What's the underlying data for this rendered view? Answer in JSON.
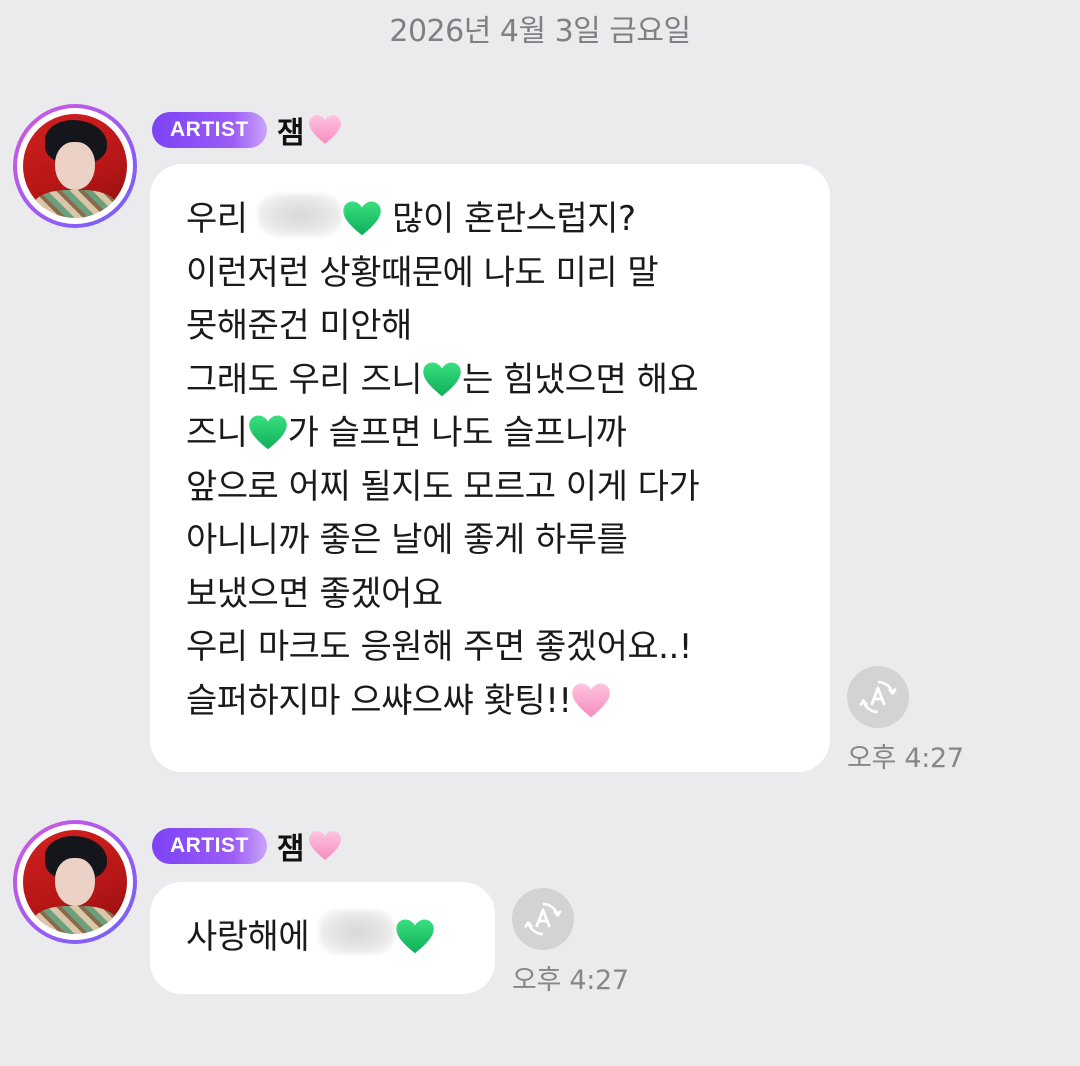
{
  "date_divider": "2026년 4월 3일 금요일",
  "colors": {
    "background": "#ebebed",
    "bubble": "#ffffff",
    "badge_gradient_start": "#7c43f5",
    "badge_gradient_end": "#c9a4f9",
    "heart_green": "#1fc46a",
    "heart_pink": "#f9a8cf",
    "avatar_ring": "#9a5cf2",
    "translate_button": "#d3d3d6"
  },
  "messages": [
    {
      "badge": "ARTIST",
      "sender": "잼",
      "sender_emoji": "pink-heart",
      "lines": [
        {
          "before": "우리 ",
          "after": " 많이 혼란스럽지?"
        },
        {
          "text": "이런저런 상황때문에 나도 미리 말"
        },
        {
          "text": "못해준건 미안해"
        },
        {
          "before": "그래도 우리 즈니",
          "after": "는 힘냈으면 해요"
        },
        {
          "before": "즈니",
          "after": "가 슬프면 나도 슬프니까"
        },
        {
          "text": "앞으로 어찌 될지도 모르고 이게 다가"
        },
        {
          "text": "아니니까 좋은 날에 좋게 하루를"
        },
        {
          "text": "보냈으면 좋겠어요"
        },
        {
          "text": "우리 마크도 응원해 주면 좋겠어요..!"
        },
        {
          "before": "슬퍼하지마 으쌰으쌰 홧팅!!",
          "after": ""
        }
      ],
      "time": "오후 4:27",
      "translate_icon": "translate-icon"
    },
    {
      "badge": "ARTIST",
      "sender": "잼",
      "sender_emoji": "pink-heart",
      "lines": [
        {
          "before": "사랑해에 ",
          "after": ""
        }
      ],
      "time": "오후 4:27",
      "translate_icon": "translate-icon"
    }
  ]
}
